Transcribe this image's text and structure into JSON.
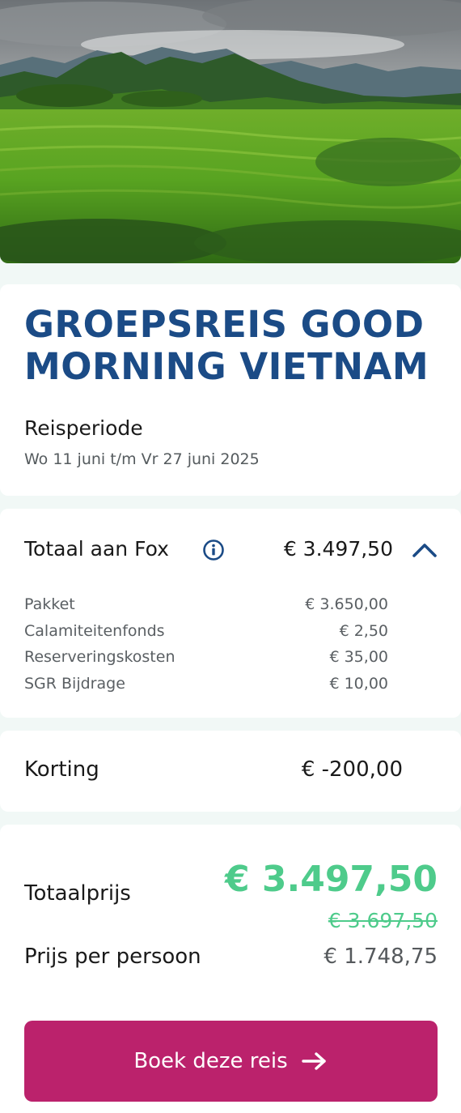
{
  "trip": {
    "title": "GROEPSREIS GOOD MORNING VIETNAM",
    "period_label": "Reisperiode",
    "period_dates": "Wo 11 juni t/m Vr 27 juni 2025"
  },
  "fox": {
    "label": "Totaal aan Fox",
    "total": "€ 3.497,50",
    "info_icon": "info-icon",
    "toggle_icon": "chevron-up-icon",
    "items": [
      {
        "label": "Pakket",
        "value": "€ 3.650,00"
      },
      {
        "label": "Calamiteitenfonds",
        "value": "€ 2,50"
      },
      {
        "label": "Reserveringskosten",
        "value": "€ 35,00"
      },
      {
        "label": "SGR Bijdrage",
        "value": "€ 10,00"
      }
    ]
  },
  "discount": {
    "label": "Korting",
    "value": "€ -200,00"
  },
  "summary": {
    "total_label": "Totaalprijs",
    "total_price": "€ 3.497,50",
    "old_price": "€ 3.697,50",
    "per_person_label": "Prijs per persoon",
    "per_person_value": "€ 1.748,75"
  },
  "cta": {
    "label": "Boek deze reis",
    "icon": "arrow-right-icon"
  },
  "colors": {
    "title_blue": "#1b4b86",
    "price_green": "#4ecb8b",
    "button_magenta": "#bb226c",
    "background": "#f1f8f6"
  }
}
